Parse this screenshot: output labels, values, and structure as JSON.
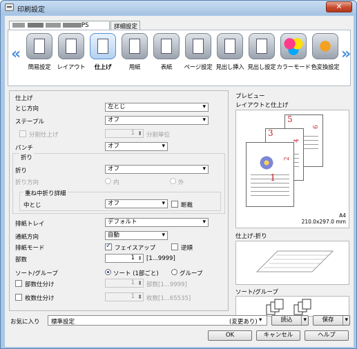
{
  "window": {
    "title": "印刷設定",
    "close_label": "✕"
  },
  "tabs": [
    {
      "label": "PS"
    },
    {
      "label": "詳細設定"
    }
  ],
  "nav": {
    "left_arrow": "«",
    "right_arrow": "»"
  },
  "functions": [
    {
      "label": "簡易設定",
      "icon": "basic-settings-icon"
    },
    {
      "label": "レイアウト",
      "icon": "layout-icon"
    },
    {
      "label": "仕上げ",
      "icon": "finishing-icon",
      "active": true
    },
    {
      "label": "用紙",
      "icon": "paper-icon"
    },
    {
      "label": "表紙",
      "icon": "cover-icon"
    },
    {
      "label": "ページ設定",
      "icon": "page-setup-icon"
    },
    {
      "label": "見出し挿入",
      "icon": "tab-insert-icon"
    },
    {
      "label": "見出し設定",
      "icon": "tab-settings-icon"
    },
    {
      "label": "カラーモード",
      "icon": "color-mode-icon"
    },
    {
      "label": "色変換設定",
      "icon": "color-convert-icon"
    }
  ],
  "finishing": {
    "section_title": "仕上げ",
    "binding_label": "とじ方向",
    "binding_value": "左とじ",
    "staple_label": "ステープル",
    "staple_value": "オフ",
    "split_label": "分割仕上げ",
    "split_count": "1",
    "split_unit": "分割単位",
    "punch_label": "パンチ",
    "punch_value": "オフ",
    "fold_group": "折り",
    "fold_label": "折り",
    "fold_value": "オフ",
    "fold_dir_label": "折り方向",
    "fold_in": "内",
    "fold_out": "外",
    "saddle_group": "重ね中折り詳細",
    "saddle_label": "中とじ",
    "saddle_value": "オフ",
    "trim_label": "断裁",
    "tray_label": "排紙トレイ",
    "tray_value": "デフォルト",
    "feed_label": "通紙方向",
    "feed_value": "自動",
    "output_label": "排紙モード",
    "faceup_label": "フェイスアップ",
    "reverse_label": "逆順",
    "copies_label": "部数",
    "copies_value": "1",
    "copies_range": "[1...9999]",
    "sort_label": "ソート/グループ",
    "sort_option": "ソート (1部ごと)",
    "group_option": "グループ",
    "set_split_label": "部数仕分け",
    "set_split_value": "1",
    "set_split_range": "部数[1...9999]",
    "sheet_split_label": "枚数仕分け",
    "sheet_split_value": "1",
    "sheet_split_range": "枚数[1...65535]"
  },
  "preview": {
    "title": "プレビュー",
    "subtitle": "レイアウトと仕上げ",
    "pages": [
      "1",
      "2",
      "3",
      "4",
      "5",
      "6"
    ],
    "paper": "A4",
    "paper_size": "210.0x297.0 mm",
    "fold_title": "仕上げ-折り",
    "sort_title": "ソート/グループ"
  },
  "favorites": {
    "label": "お気に入り",
    "value": "標準設定",
    "changed": "(変更あり)",
    "load_label": "読込",
    "save_label": "保存"
  },
  "buttons": {
    "ok": "OK",
    "cancel": "キャンセル",
    "help": "ヘルプ"
  }
}
